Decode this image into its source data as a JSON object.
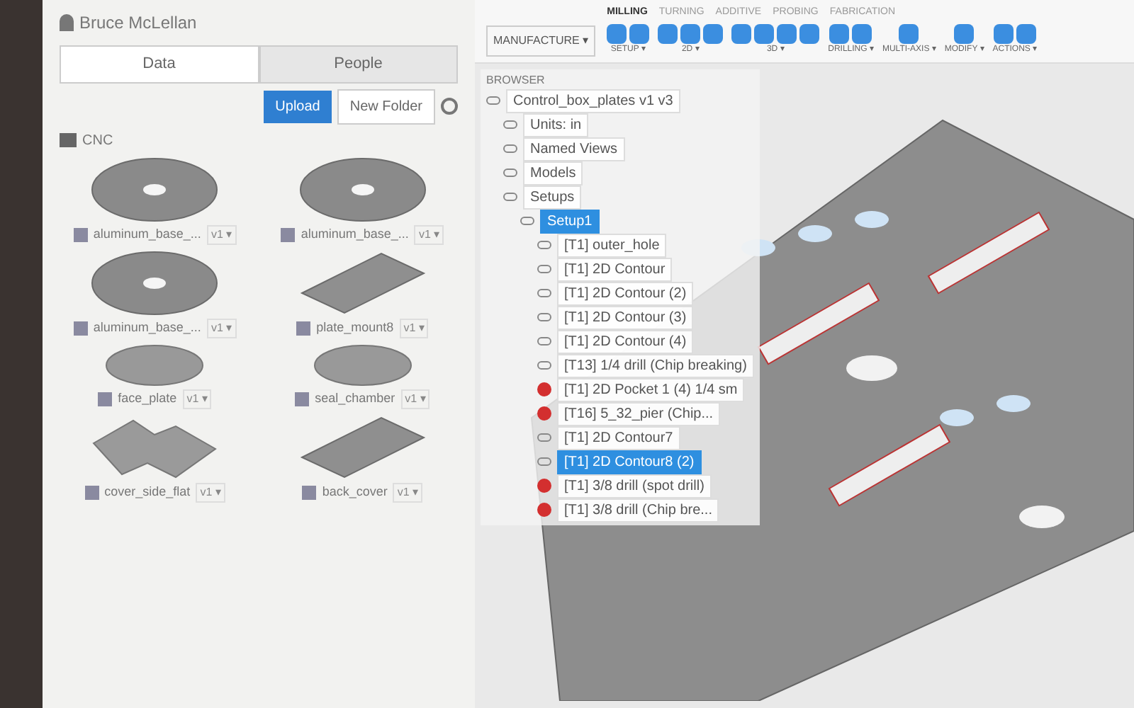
{
  "data_panel": {
    "user": "Bruce McLellan",
    "tabs": [
      {
        "label": "Data",
        "selected": true
      },
      {
        "label": "People",
        "selected": false
      }
    ],
    "buttons": [
      {
        "label": "Upload",
        "kind": "primary"
      },
      {
        "label": "New Folder",
        "kind": "secondary"
      }
    ],
    "breadcrumb": [
      "CNC"
    ],
    "files": [
      {
        "name": "aluminum_base_...",
        "version": "v1 ▾",
        "kind": "disc"
      },
      {
        "name": "aluminum_base_...",
        "version": "v1 ▾",
        "kind": "disc"
      },
      {
        "name": "aluminum_base_...",
        "version": "v1 ▾",
        "kind": "disc"
      },
      {
        "name": "plate_mount8",
        "version": "v1 ▾",
        "kind": "plate"
      },
      {
        "name": "face_plate",
        "version": "v1 ▾",
        "kind": "small-disc"
      },
      {
        "name": "seal_chamber",
        "version": "v1 ▾",
        "kind": "small-disc"
      },
      {
        "name": "cover_side_flat",
        "version": "v1 ▾",
        "kind": "notched"
      },
      {
        "name": "back_cover",
        "version": "v1 ▾",
        "kind": "plate"
      }
    ]
  },
  "toolbar": {
    "workspace": "MANUFACTURE ▾",
    "tabs": [
      {
        "label": "MILLING",
        "selected": true
      },
      {
        "label": "TURNING",
        "selected": false
      },
      {
        "label": "ADDITIVE",
        "selected": false
      },
      {
        "label": "PROBING",
        "selected": false
      },
      {
        "label": "FABRICATION",
        "selected": false
      }
    ],
    "groups": [
      {
        "label": "SETUP ▾"
      },
      {
        "label": "2D ▾"
      },
      {
        "label": "3D ▾"
      },
      {
        "label": "DRILLING ▾"
      },
      {
        "label": "MULTI-AXIS ▾"
      },
      {
        "label": "MODIFY ▾"
      },
      {
        "label": "ACTIONS ▾"
      }
    ]
  },
  "browser": {
    "title": "BROWSER",
    "tree": [
      {
        "label": "Control_box_plates v1 v3",
        "error": false,
        "children": [
          {
            "label": "Units: in",
            "error": false
          },
          {
            "label": "Named Views",
            "error": false
          },
          {
            "label": "Models",
            "error": false
          },
          {
            "label": "Setups",
            "error": false,
            "children": [
              {
                "label": "Setup1",
                "error": false,
                "selected": true,
                "children": [
                  {
                    "label": "[T1] outer_hole",
                    "error": false,
                    "selected": false
                  },
                  {
                    "label": "[T1] 2D Contour",
                    "error": false,
                    "selected": false
                  },
                  {
                    "label": "[T1] 2D Contour (2)",
                    "error": false,
                    "selected": false
                  },
                  {
                    "label": "[T1] 2D Contour (3)",
                    "error": false,
                    "selected": false
                  },
                  {
                    "label": "[T1] 2D Contour (4)",
                    "error": false,
                    "selected": false
                  },
                  {
                    "label": "[T13] 1/4 drill (Chip breaking)",
                    "error": false,
                    "selected": false
                  },
                  {
                    "label": "[T1] 2D Pocket 1 (4) 1/4 sm",
                    "error": true,
                    "selected": false
                  },
                  {
                    "label": "[T16] 5_32_pier (Chip...",
                    "error": true,
                    "selected": false
                  },
                  {
                    "label": "[T1] 2D Contour7",
                    "error": false,
                    "selected": false
                  },
                  {
                    "label": "[T1] 2D Contour8 (2)",
                    "error": false,
                    "selected": true
                  },
                  {
                    "label": "[T1] 3/8 drill (spot drill)",
                    "error": true,
                    "selected": false
                  },
                  {
                    "label": "[T1] 3/8 drill (Chip bre...",
                    "error": true,
                    "selected": false
                  }
                ]
              }
            ]
          }
        ]
      }
    ]
  }
}
